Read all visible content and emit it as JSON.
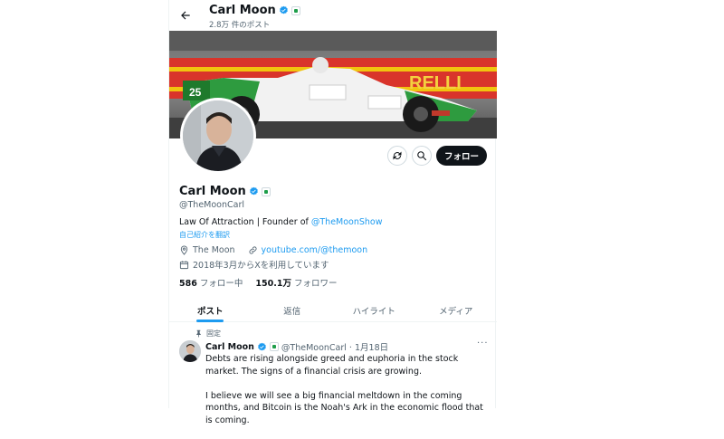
{
  "header": {
    "name": "Carl Moon",
    "post_count": "2.8万 件のポスト"
  },
  "profile": {
    "name": "Carl Moon",
    "handle": "@TheMoonCarl",
    "bio_prefix": "Law Of Attraction | Founder of ",
    "bio_link": "@TheMoonShow",
    "translate": "自己紹介を翻訳",
    "location": "The Moon",
    "website": "youtube.com/@themoon",
    "joined": "2018年3月からXを利用しています",
    "following_count": "586",
    "following_label": "フォロー中",
    "followers_count": "150.1万",
    "followers_label": "フォロワー",
    "follow_button": "フォロー"
  },
  "banner": {
    "car_number": "25",
    "sponsor_text": "RELLI"
  },
  "tabs": [
    {
      "label": "ポスト",
      "active": true
    },
    {
      "label": "返信",
      "active": false
    },
    {
      "label": "ハイライト",
      "active": false
    },
    {
      "label": "メディア",
      "active": false
    }
  ],
  "tweet": {
    "pinned_label": "固定",
    "name": "Carl Moon",
    "handle_date": "@TheMoonCarl · 1月18日",
    "more": "···",
    "paragraph1": "Debts are rising alongside greed and euphoria in the stock market. The signs of a financial crisis are growing.",
    "paragraph2": "I believe we will see a big financial meltdown in the coming months, and Bitcoin is the Noah's Ark in the economic flood that is coming."
  },
  "colors": {
    "accent": "#1d9bf0",
    "text": "#0f1419",
    "muted": "#536471",
    "verified": "#1d9bf0",
    "follow_bg": "#0f1419"
  },
  "icons": {
    "back": "arrow-left-icon",
    "verified": "verified-badge-icon",
    "affiliate": "affiliate-badge-icon",
    "location": "location-pin-icon",
    "link": "link-icon",
    "calendar": "calendar-icon",
    "pin": "pin-icon",
    "subscribe": "refresh-circle-icon",
    "search": "search-icon",
    "more": "more-dots-icon"
  }
}
